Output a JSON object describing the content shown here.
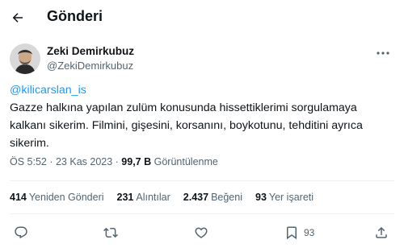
{
  "header": {
    "title": "Gönderi"
  },
  "author": {
    "name": "Zeki Demirkubuz",
    "handle": "@ZekiDemirkubuz"
  },
  "tweet": {
    "mention": "@kilicarslan_is",
    "text": "Gazze halkına yapılan zulüm  konusunda hissettiklerimi sorgulamaya kalkanı sikerim. Filmini, gişesini, korsanını, boykotunu, tehditini ayrıca sikerim."
  },
  "meta": {
    "time": "ÖS 5:52",
    "separator": " · ",
    "date": "23 Kas 2023",
    "views_count": "99,7 B",
    "views_label": "Görüntülenme"
  },
  "stats": {
    "reposts_count": "414",
    "reposts_label": "Yeniden Gönderi",
    "quotes_count": "231",
    "quotes_label": "Alıntılar",
    "likes_count": "2.437",
    "likes_label": "Beğeni",
    "bookmarks_count": "93",
    "bookmarks_label": "Yer işareti"
  },
  "actions": {
    "bookmark_count": "93"
  },
  "icons": {
    "back": "arrow-left-icon",
    "more": "more-horizontal-icon",
    "reply": "reply-icon",
    "repost": "repost-icon",
    "like": "heart-icon",
    "bookmark": "bookmark-icon",
    "share": "share-icon"
  },
  "colors": {
    "text": "#0f1419",
    "secondary": "#536471",
    "link": "#1d9bf0",
    "divider": "#eff3f4"
  }
}
